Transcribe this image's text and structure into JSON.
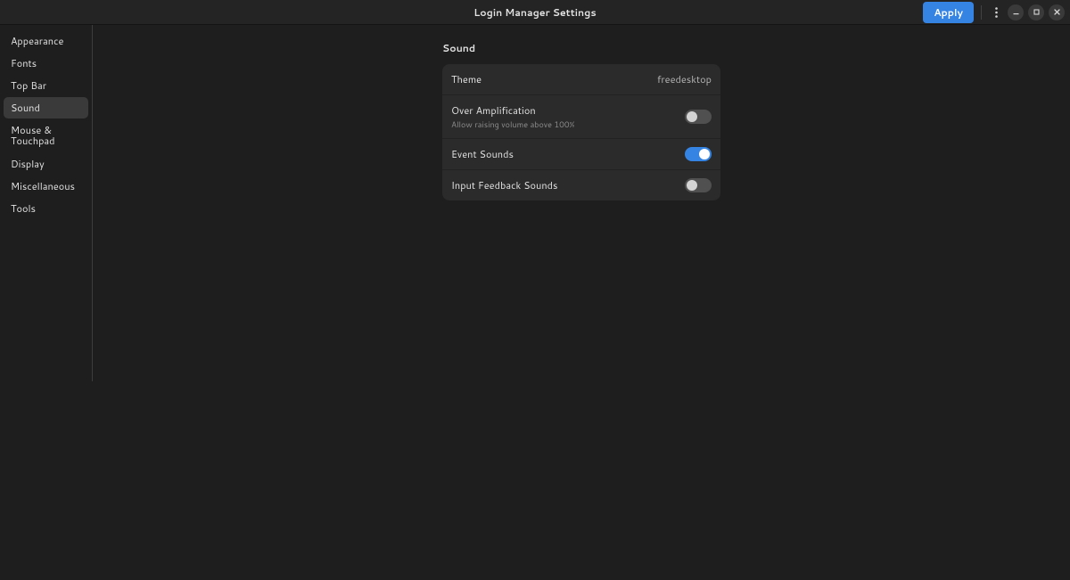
{
  "header": {
    "title": "Login Manager Settings",
    "apply_label": "Apply"
  },
  "sidebar": {
    "items": [
      {
        "label": "Appearance"
      },
      {
        "label": "Fonts"
      },
      {
        "label": "Top Bar"
      },
      {
        "label": "Sound"
      },
      {
        "label": "Mouse & Touchpad"
      },
      {
        "label": "Display"
      },
      {
        "label": "Miscellaneous"
      },
      {
        "label": "Tools"
      }
    ],
    "selected_index": 3
  },
  "section": {
    "title": "Sound",
    "rows": {
      "theme": {
        "label": "Theme",
        "value": "freedesktop"
      },
      "over_amp": {
        "label": "Over Amplification",
        "sub": "Allow raising volume above 100%",
        "on": false
      },
      "event_sounds": {
        "label": "Event Sounds",
        "on": true
      },
      "input_feedback": {
        "label": "Input Feedback Sounds",
        "on": false
      }
    }
  }
}
